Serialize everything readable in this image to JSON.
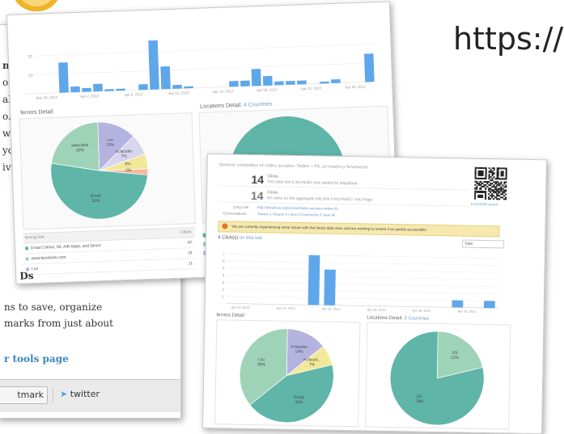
{
  "right_url": "https://",
  "back_page": {
    "char_bookmark": "t",
    "lines": [
      "ns to save, organize",
      "marks from just about"
    ],
    "link": "r tools page",
    "buttons": {
      "bookmark": "tmark",
      "twitter": "twitter"
    }
  },
  "left_partial_lines": [
    "n",
    "oc",
    "al",
    "o.",
    "w",
    "yc",
    "ivi"
  ],
  "top_shot": {
    "bar_chart": {
      "y_ticks": [
        "20",
        "10"
      ],
      "x_labels": [
        "Mar 29, 2012",
        "Apr 2, 2012",
        "Apr 6, 2012",
        "Apr 10, 2012",
        "Apr 14, 2012",
        "Apr 18, 2012",
        "Apr 22, 2012",
        "Apr 26, 2012"
      ],
      "values": [
        0,
        0,
        16,
        3,
        2,
        4,
        1,
        1,
        0,
        3,
        26,
        12,
        2,
        1,
        0,
        0,
        0,
        3,
        3,
        9,
        5,
        2,
        2,
        2,
        0,
        1,
        2,
        0,
        0,
        15
      ]
    },
    "referrers_title": "ferrers Detail",
    "locations_title": "Locations Detail:",
    "locations_count": "4 Countries",
    "pie": {
      "labels": [
        {
          "text": "t.co\n13%"
        },
        {
          "text": "m.facebo\n7%"
        },
        {
          "text": "5%"
        },
        {
          "text": "2%"
        },
        {
          "text": "www.face\n22%"
        },
        {
          "text": "Email\n51%"
        }
      ]
    },
    "table_header": {
      "col1": "ferring Site",
      "col2": "Clicks"
    },
    "table_rows": [
      {
        "site": "Email Clients, IM, AIR Apps, and Direct",
        "clicks": "42"
      },
      {
        "site": "www.facebook.com",
        "clicks": "18"
      },
      {
        "site": "t.co",
        "clicks": "11"
      }
    ],
    "bottom_label": "Ds"
  },
  "front_shot": {
    "heading": "Generar contenidos en redes sociales: Twitter + Fb, un mucho y fenomenal",
    "stat1": {
      "num": "14",
      "title": "Clicks",
      "desc": "This bitly link  b.lt/yV9uB2  was added by  biagafada"
    },
    "stat2": {
      "num": "14",
      "title": "Clicks",
      "desc": "All clicks on the aggregate bitly link  b.lt/yV9uB2  /  Info Page"
    },
    "long_link_label": "Long Link",
    "long_link": "http://dmaticas.org/sociali/redes-sociales-twitter-fb",
    "conversations_label": "Conversations",
    "conversations": "Tweets 1   Shares 0   Likes 0   Comments 0   View All",
    "qr_caption": "b.lt/yV9uB2.qrcode",
    "alert": "We are currently experiencing some issues with the hourly data view, and are working to restore it as quickly as possible!",
    "clicks_title": "4 Click(s)",
    "clicks_sub": "on this link",
    "total_label": "Total",
    "y_ticks": [
      "7",
      "6",
      "5",
      "4",
      "3",
      "2",
      "1"
    ],
    "x_labels": [
      "Apr 10, 2012",
      "Apr 12, 2012",
      "Apr 14, 2012",
      "Apr 16, 2012",
      "Apr 18, 2012",
      "Apr 20, 2012"
    ],
    "bar_values": [
      0,
      0,
      0,
      0,
      0,
      7,
      5,
      0,
      0,
      0,
      0,
      0,
      0,
      0,
      1,
      0,
      1
    ],
    "referrers_title": "ferrers Detail",
    "locations_title": "Locations Detail:",
    "locations_count": "3 Countries",
    "pie1_labels": [
      {
        "text": "t.co\n35%"
      },
      {
        "text": "m.facebo\n14%"
      },
      {
        "text": "m.faceb...\n7%"
      },
      {
        "text": "Email\n43%"
      }
    ],
    "pie2_labels": [
      {
        "text": "ES\n79%"
      },
      {
        "text": "US\n21%"
      }
    ]
  },
  "colors": {
    "teal": "#5fb5a8",
    "mint": "#9fd3b8",
    "lavender": "#b4b3e0",
    "yellow": "#f2e89a",
    "peach": "#f7b8a0",
    "blue": "#5fa7ea",
    "alert": "#f6e9b0"
  }
}
